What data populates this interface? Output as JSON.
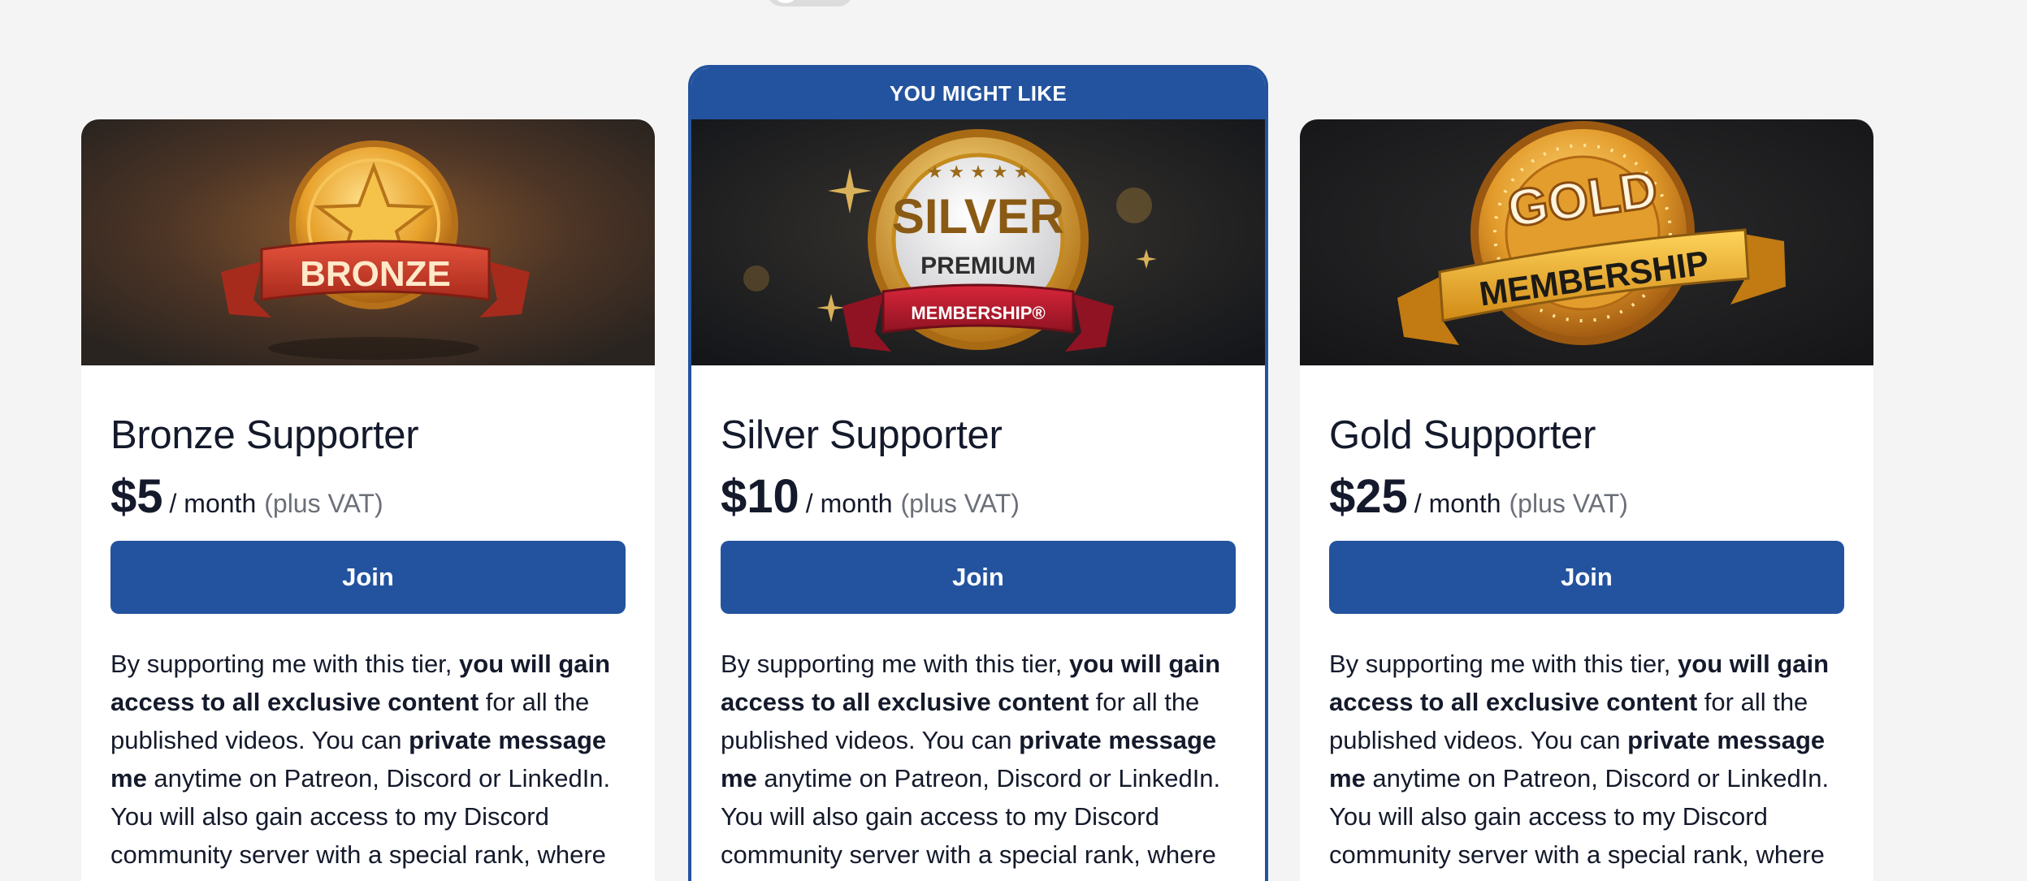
{
  "recommended_label": "YOU MIGHT LIKE",
  "tiers": [
    {
      "title": "Bronze Supporter",
      "price": "$5",
      "period": "/ month",
      "vat": "(plus VAT)",
      "join_label": "Join",
      "badge": {
        "main": "BRONZE"
      },
      "desc": {
        "a": "By supporting me with this tier, ",
        "b": "you will gain access to all exclusive content",
        "c": " for all the published videos. You can ",
        "d": "private message me",
        "e": " anytime on Patreon, Discord or LinkedIn. You will also gain access to my Discord community server with a special rank, where"
      }
    },
    {
      "title": "Silver Supporter",
      "price": "$10",
      "period": "/ month",
      "vat": "(plus VAT)",
      "join_label": "Join",
      "badge": {
        "main": "SILVER",
        "sub": "PREMIUM",
        "ribbon": "MEMBERSHIP®"
      },
      "desc": {
        "a": "By supporting me with this tier, ",
        "b": "you will gain access to all exclusive content",
        "c": " for all the published videos. You can ",
        "d": "private message me",
        "e": " anytime on Patreon, Discord or LinkedIn. You will also gain access to my Discord community server with a special rank, where"
      }
    },
    {
      "title": "Gold Supporter",
      "price": "$25",
      "period": "/ month",
      "vat": "(plus VAT)",
      "join_label": "Join",
      "badge": {
        "main": "GOLD",
        "ribbon": "MEMBERSHIP"
      },
      "desc": {
        "a": "By supporting me with this tier, ",
        "b": "you will gain access to all exclusive content",
        "c": " for all the published videos. You can ",
        "d": "private message me",
        "e": " anytime on Patreon, Discord or LinkedIn. You will also gain access to my Discord community server with a special rank, where"
      }
    }
  ],
  "colors": {
    "accent": "#23539e",
    "background": "#f4f4f4",
    "text": "#141a2b",
    "muted": "#6b6f78"
  }
}
